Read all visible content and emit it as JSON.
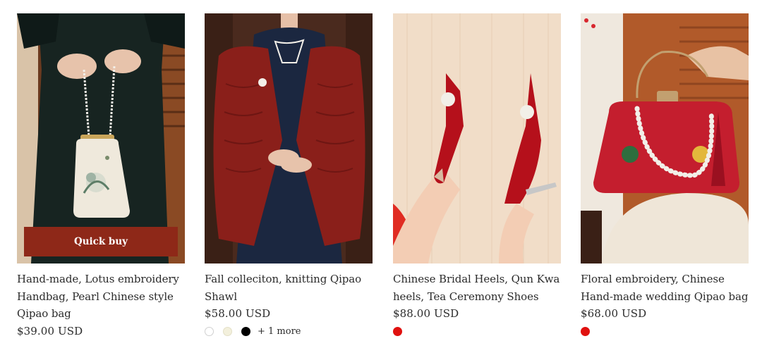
{
  "products": [
    {
      "title": "Hand-made, Lotus embroidery Handbag, Pearl Chinese style Qipao bag",
      "price": "$39.00 USD",
      "quick_buy_label": "Quick buy",
      "swatches": []
    },
    {
      "title": "Fall colleciton, knitting Qipao Shawl",
      "price": "$58.00 USD",
      "swatches": [
        "#ffffff",
        "#f3f0dc",
        "#000000"
      ],
      "more_label": "+ 1 more"
    },
    {
      "title": "Chinese Bridal Heels, Qun Kwa heels, Tea Ceremony Shoes",
      "price": "$88.00 USD",
      "swatches": [
        "#e0110f"
      ]
    },
    {
      "title": "Floral embroidery, Chinese Hand-made wedding Qipao bag",
      "price": "$68.00 USD",
      "swatches": [
        "#e0110f"
      ]
    }
  ]
}
